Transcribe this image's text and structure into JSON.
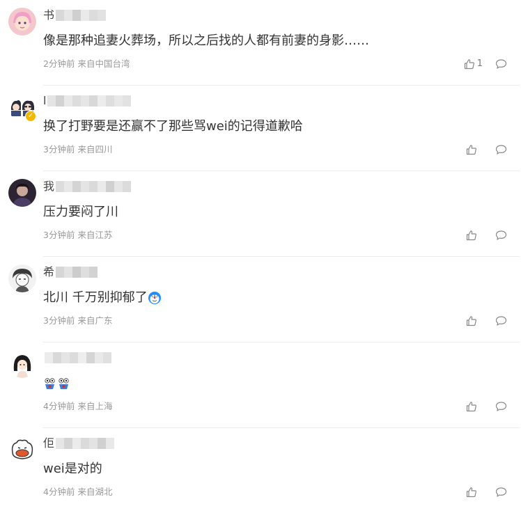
{
  "icons": {
    "like": "thumbs-up-icon",
    "comment": "comment-bubble-icon",
    "verified": "verified-badge-icon"
  },
  "colors": {
    "meta_text": "#999999",
    "body_text": "#333333",
    "divider": "#ececec",
    "verified_badge": "#f5b800"
  },
  "comments": [
    {
      "username_prefix": "书",
      "text": "像是那种追妻火葬场，所以之后找的人都有前妻的身影……",
      "time": "2分钟前",
      "location": "来自中国台湾",
      "likes": "1"
    },
    {
      "username_prefix": "l",
      "text": "换了打野要是还赢不了那些骂wei的记得道歉哈",
      "time": "3分钟前",
      "location": "来自四川",
      "likes": ""
    },
    {
      "username_prefix": "我",
      "text": "压力要闷了川",
      "time": "3分钟前",
      "location": "来自江苏",
      "likes": ""
    },
    {
      "username_prefix": "希",
      "text": "北川 千万别抑郁了",
      "text_emoji": "doraemon-emoji",
      "time": "3分钟前",
      "location": "来自广东",
      "likes": ""
    },
    {
      "username_prefix": "",
      "text": "",
      "text_emoji": "shocked-emoji-pair",
      "time": "4分钟前",
      "location": "来自上海",
      "likes": ""
    },
    {
      "username_prefix": "佢",
      "text": "wei是对的",
      "time": "4分钟前",
      "location": "来自湖北",
      "likes": ""
    }
  ]
}
